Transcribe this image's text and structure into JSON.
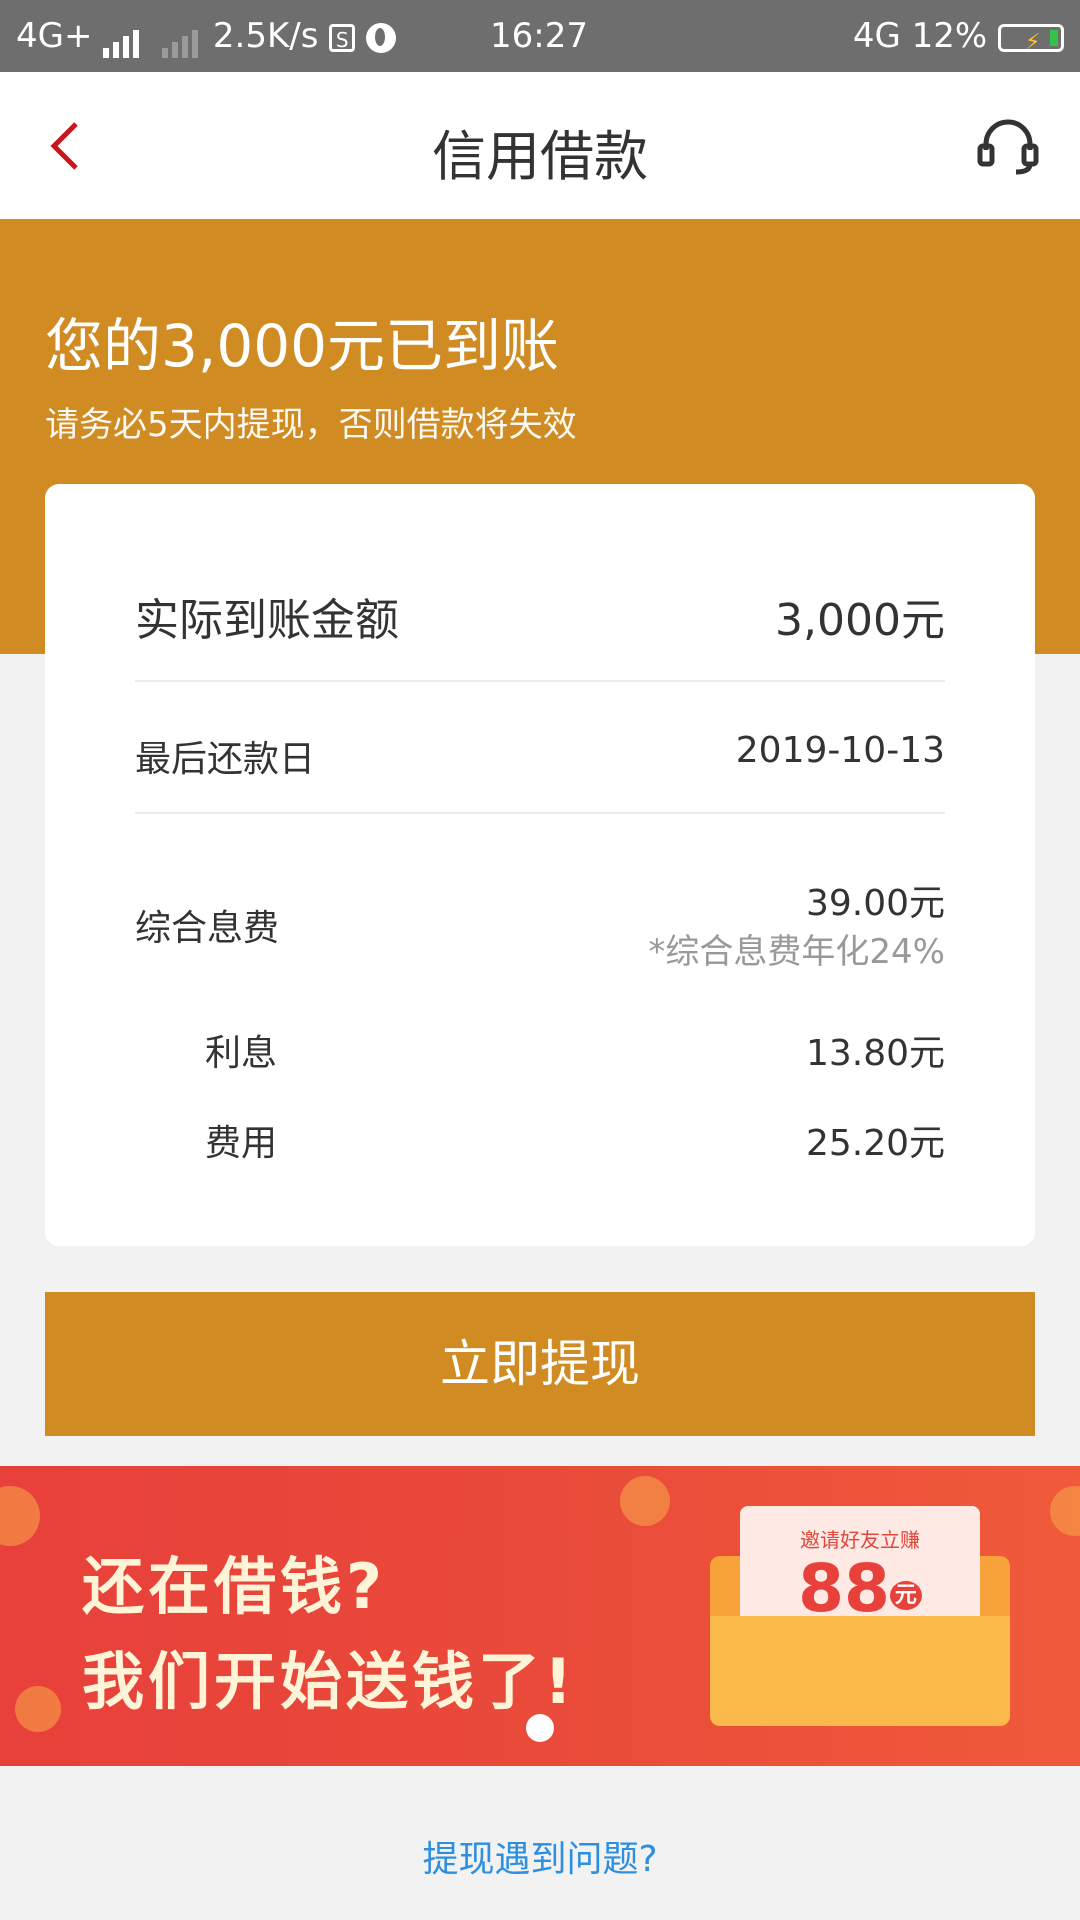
{
  "status_bar": {
    "network_left": "4G+",
    "speed": "2.5K/s",
    "s_icon": "S",
    "time": "16:27",
    "network_right": "4G",
    "battery": "12%"
  },
  "nav": {
    "title": "信用借款",
    "back_icon": "chevron-left-icon",
    "service_icon": "headset-icon"
  },
  "hero": {
    "title": "您的3,000元已到账",
    "subtitle": "请务必5天内提现，否则借款将失效"
  },
  "card": {
    "actual_amount_label": "实际到账金额",
    "actual_amount_value": "3,000元",
    "due_date_label": "最后还款日",
    "due_date_value": "2019-10-13",
    "fee_label": "综合息费",
    "fee_value": "39.00元",
    "fee_note": "*综合息费年化24%",
    "interest_label": "利息",
    "interest_value": "13.80元",
    "charge_label": "费用",
    "charge_value": "25.20元"
  },
  "withdraw_button": "立即提现",
  "banner": {
    "line1": "还在借钱?",
    "line2": "我们开始送钱了!",
    "invite": "邀请好友立赚",
    "amount": "88",
    "unit": "元"
  },
  "help_link": "提现遇到问题?",
  "colors": {
    "accent": "#d08b22",
    "link": "#2e8fe0",
    "banner": "#e8403a"
  }
}
